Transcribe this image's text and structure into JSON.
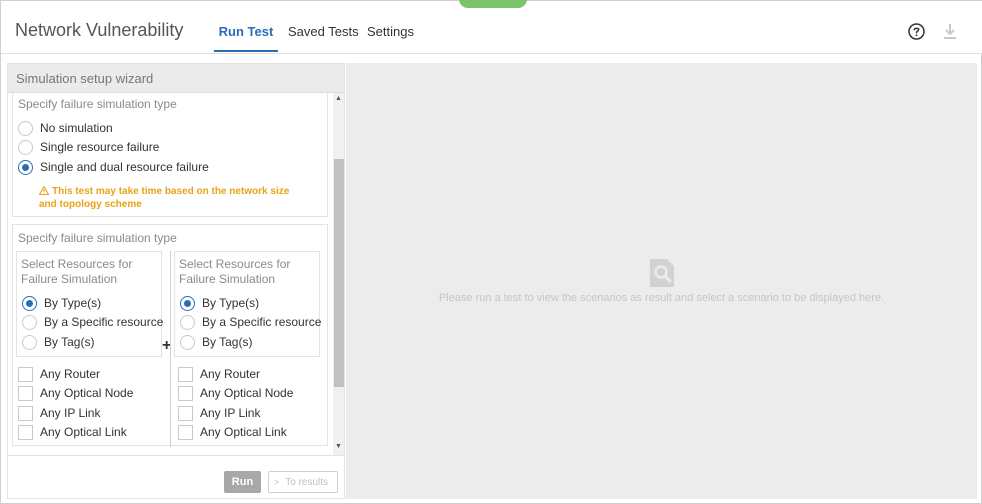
{
  "header": {
    "app_title": "Network Vulnerability",
    "tabs": [
      {
        "label": "Run Test",
        "active": true
      },
      {
        "label": "Saved Tests",
        "active": false
      },
      {
        "label": "Settings",
        "active": false
      }
    ],
    "icons": [
      "help-icon",
      "download-icon"
    ],
    "accent_color": "#2a6db6"
  },
  "wizard": {
    "title": "Simulation setup wizard",
    "section1": {
      "title": "Specify failure simulation type",
      "options": [
        {
          "label": "No simulation",
          "checked": false
        },
        {
          "label": "Single resource failure",
          "checked": false
        },
        {
          "label": "Single and dual resource failure",
          "checked": true
        }
      ],
      "warning": "This test may take time based on the network size and topology scheme",
      "warning_color": "#e8a317"
    },
    "section2": {
      "title": "Specify failure simulation type",
      "left": {
        "title": "Select Resources for Failure Simulation",
        "options": [
          {
            "label": "By Type(s)",
            "checked": true
          },
          {
            "label": "By a Specific resource",
            "checked": false
          },
          {
            "label": "By Tag(s)",
            "checked": false
          }
        ],
        "checks": [
          "Any Router",
          "Any Optical Node",
          "Any IP Link",
          "Any Optical Link"
        ]
      },
      "right": {
        "title": "Select Resources for Failure Simulation",
        "options": [
          {
            "label": "By Type(s)",
            "checked": true
          },
          {
            "label": "By a Specific resource",
            "checked": false
          },
          {
            "label": "By Tag(s)",
            "checked": false
          }
        ],
        "checks": [
          "Any Router",
          "Any Optical Node",
          "Any IP Link",
          "Any Optical Link"
        ]
      },
      "plus": "+"
    },
    "footer": {
      "run_label": "Run",
      "results_label": "To results"
    }
  },
  "results_panel": {
    "empty_message": "Please run a test to view the scenarios as result and select a scenario to be displayed here.",
    "icon": "search-document-icon"
  }
}
